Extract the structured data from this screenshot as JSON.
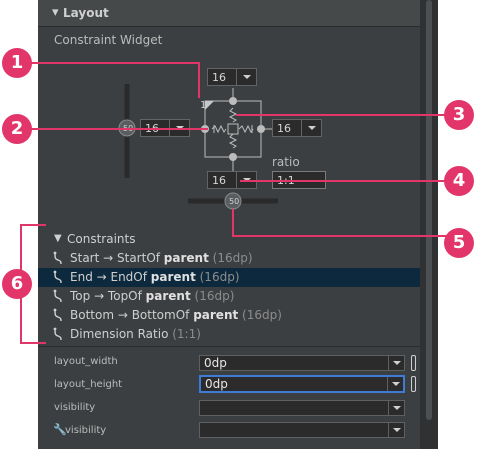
{
  "section": {
    "layout_title": "Layout",
    "widget_title": "Constraint Widget"
  },
  "widget": {
    "margin_top": "16",
    "margin_start": "16",
    "margin_end": "16",
    "margin_bottom": "16",
    "ratio_label": "ratio",
    "ratio_value": "1:1",
    "ratio_corner": "1",
    "horizontal_bias": "50",
    "vertical_bias": "50"
  },
  "constraints": {
    "header": "Constraints",
    "items": [
      {
        "pre": "Start → StartOf ",
        "target": "parent",
        "post": " (16dp)",
        "selected": false
      },
      {
        "pre": "End → EndOf ",
        "target": "parent",
        "post": " (16dp)",
        "selected": true
      },
      {
        "pre": "Top → TopOf ",
        "target": "parent",
        "post": " (16dp)",
        "selected": false
      },
      {
        "pre": "Bottom → BottomOf ",
        "target": "parent",
        "post": " (16dp)",
        "selected": false
      },
      {
        "pre": "Dimension Ratio ",
        "target": "",
        "post": " (1:1)",
        "selected": false
      }
    ]
  },
  "properties": {
    "layout_width": {
      "label": "layout_width",
      "value": "0dp"
    },
    "layout_height": {
      "label": "layout_height",
      "value": "0dp"
    },
    "visibility": {
      "label": "visibility",
      "value": ""
    },
    "tools_visibility": {
      "label": "visibility",
      "value": ""
    }
  },
  "callouts": [
    "1",
    "2",
    "3",
    "4",
    "5",
    "6"
  ],
  "colors": {
    "accent": "#e2356a",
    "selection": "#0d293e",
    "focus": "#3d7bd6",
    "panel": "#3c3f41"
  }
}
